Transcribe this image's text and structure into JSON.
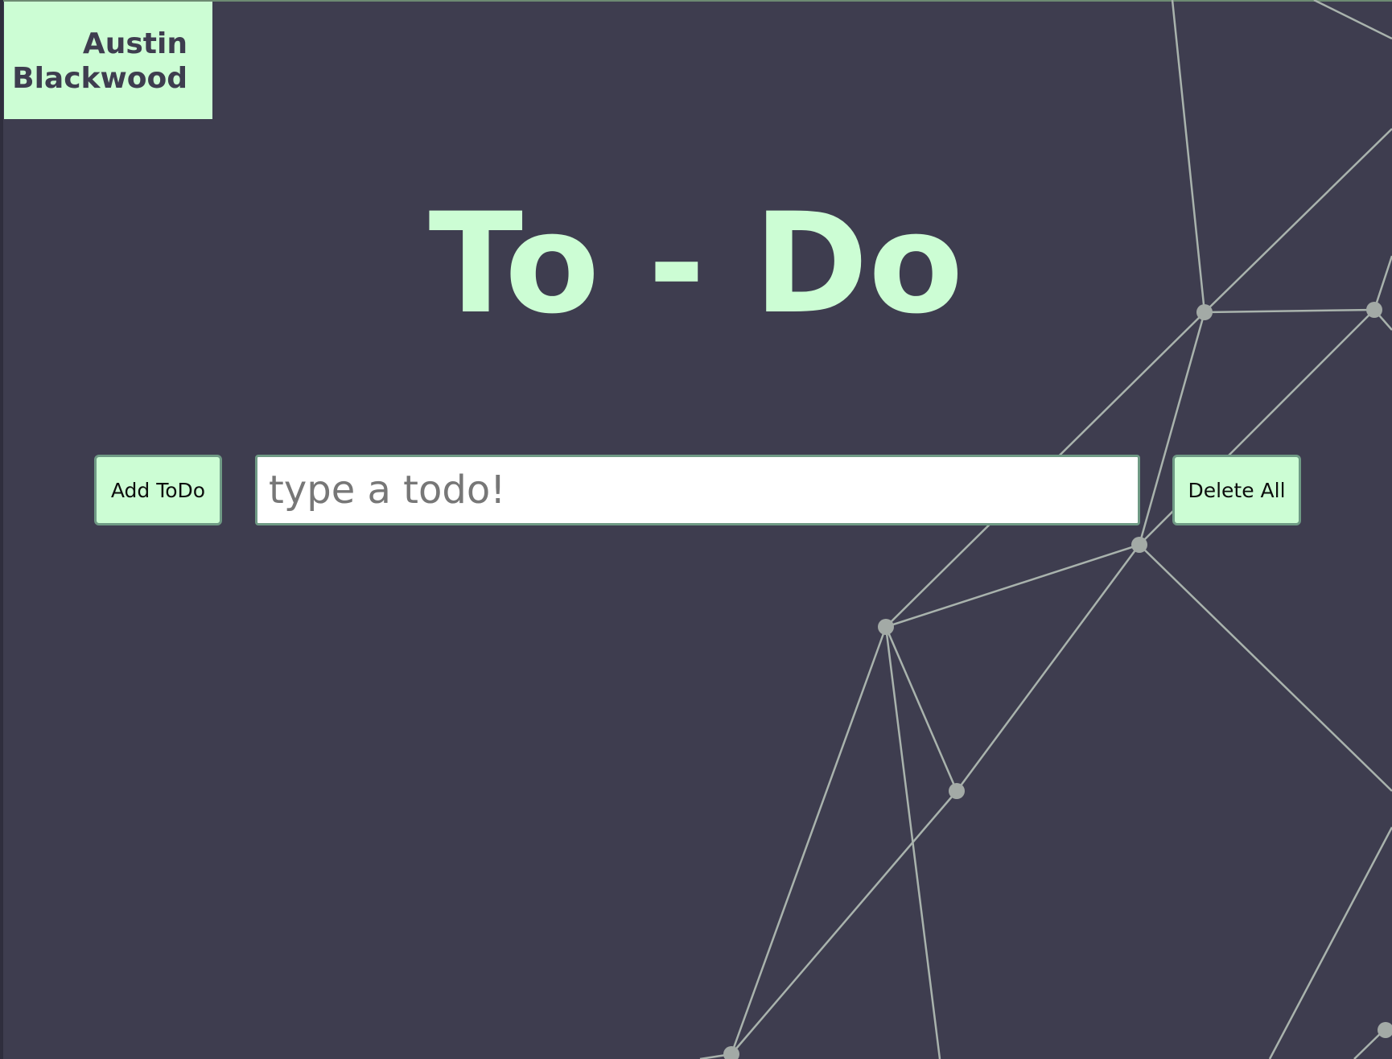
{
  "header": {
    "name_line1": "Austin",
    "name_line2": "Blackwood"
  },
  "main": {
    "title": "To - Do",
    "add_button_label": "Add ToDo",
    "input_placeholder": "type a todo!",
    "input_value": "",
    "delete_all_label": "Delete All"
  },
  "colors": {
    "background": "#3e3d4f",
    "accent": "#ccfdd4",
    "border": "#6f9a85",
    "network_line": "#a9b3ad",
    "network_node": "#a3aaa6"
  }
}
